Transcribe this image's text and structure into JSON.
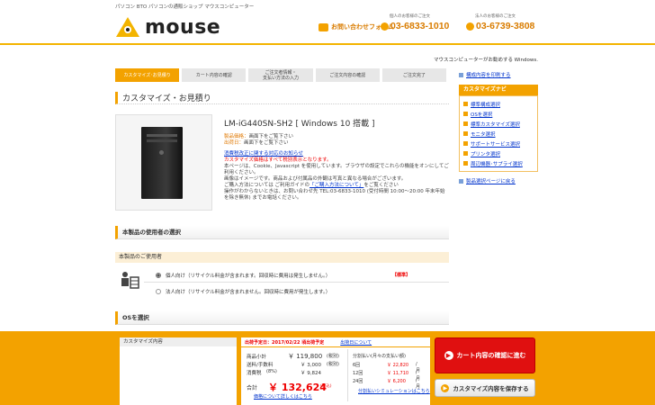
{
  "header": {
    "tagline": "パソコン BTO パソコンの通販ショップ マウスコンピューター",
    "logo_text": "mouse",
    "contact_label": "お問い合わせフォーム",
    "tel_personal_label": "個人のお客様のご注文",
    "tel_personal": "03-6833-1010",
    "tel_corp_label": "法人のお客様のご注文",
    "tel_corp": "03-6739-3808",
    "brand_tagline": "マウスコンピューターがお勧めする Windows."
  },
  "steps": [
    "カスタマイズ･お見積り",
    "カート内容の確認",
    "ご注文者情報・\n支払い方法の入力",
    "ご注文内容の確認",
    "ご注文完了"
  ],
  "main": {
    "page_title": "カスタマイズ・お見積り",
    "model": "LM-iG440SN-SH2 [ Windows 10 搭載 ]",
    "sale_label": "製品価格：",
    "sale_value": "画面下をご覧下さい",
    "ship_label": "出荷日：",
    "ship_value": "画面下をご覧下さい",
    "tax_link": "消費税改正に関する対応のお知らせ",
    "red_note": "カスタマイズ価格はすべて税別表示となります。",
    "note1": "本ページは、Cookie、Javascript を使用しています。ブラウザの設定でこれらの機能をオンにしてご利用ください。",
    "note2": "画像はイメージです。商品および付属品の外観は写真と異なる場合がございます。",
    "note3a": "ご購入方法については ご利用ガイドの",
    "note3link": "「ご購入方法について」",
    "note3b": "をご覧ください",
    "note4": "操作がわからないときは、お問い合わせ先 TEL:03-6833-1010 (受付時間 10:00～20:00 年末年始を除き無休) までお電話ください。",
    "section_user": "本製品の使用者の選択",
    "subhdr_user": "本製品のご使用者",
    "opt_personal": "個人向け（リサイクル料金が含まれます。回収時に費用は発生しません。）",
    "opt_corp": "法人向け（リサイクル料金が含まれません。回収時に費用が発生します。）",
    "badge": "【標準】",
    "section_os": "OSを選択"
  },
  "side": {
    "print_link": "構成内容を印刷する",
    "nav_title": "カスタマイズナビ",
    "nav_items": [
      "標準構成選択",
      "OSを選択",
      "標準カスタマイズ選択",
      "モニタ選択",
      "サポートサービス選択",
      "プリンタ選択",
      "周辺機器･サプライ選択"
    ],
    "back_link": "製品選択ページに戻る"
  },
  "footer": {
    "cart_header": "カスタマイズ内容",
    "ship_label": "出荷予定日：",
    "ship_date": "2017/02/22 頃出荷予定",
    "ship_link": "出荷日について",
    "subtotal_label": "商品小計",
    "subtotal": "￥ 119,800",
    "subtotal_tax": "(税別)",
    "shipping_label": "送料/手数料",
    "shipping": "￥ 3,000",
    "shipping_tax": "(税別)",
    "tax_label": "消費税",
    "tax_pct": "(8%)",
    "tax": "￥ 9,824",
    "total_label": "合計",
    "total": "￥ 132,624",
    "total_tax": "(税込)",
    "price_link": "価格について詳しくはこちら",
    "loan_title": "分割払い(月々の支払い額)",
    "loan_rows": [
      {
        "n": "6回",
        "v": "￥ 22,820",
        "u": "/月"
      },
      {
        "n": "12回",
        "v": "￥ 11,710",
        "u": "/月"
      },
      {
        "n": "24回",
        "v": "￥ 6,200",
        "u": "/月"
      }
    ],
    "loan_link": "分割払いシミュレーションはこちら",
    "cart_button": "カート内容の確認に進む",
    "save_button": "カスタマイズ内容を保存する"
  },
  "colors": {
    "accent": "#f3a200",
    "red": "#e01010",
    "link": "#0033cc"
  }
}
